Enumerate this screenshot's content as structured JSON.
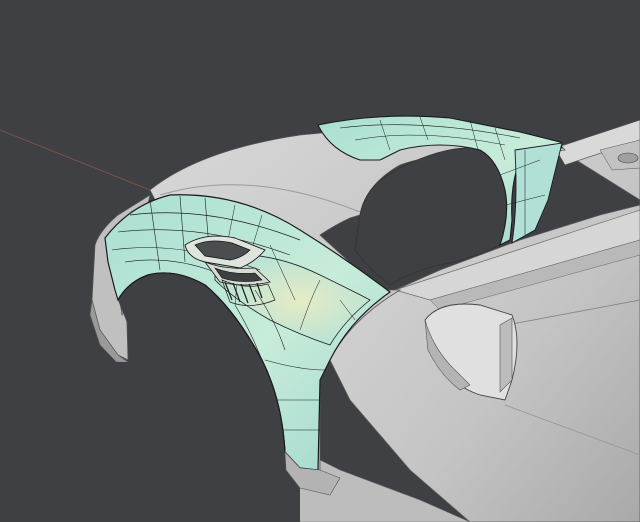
{
  "viewport": {
    "background_color": "#3f4044",
    "selection_surface_color": "#b7e6d8",
    "selection_highlight_color": "#dfe7c5",
    "unselected_surface_color": "#c9c9c9",
    "edge_color": "#1b1b1b"
  }
}
